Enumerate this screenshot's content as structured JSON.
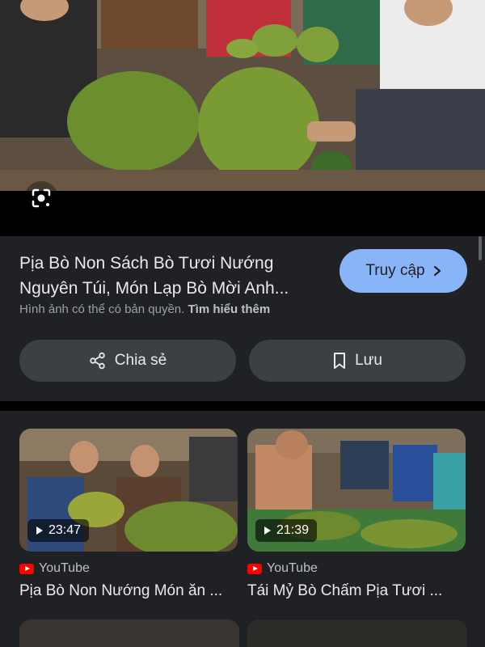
{
  "hero": {
    "image": "Ảnh: mọi người ngồi quanh những tảng thịt gói lá màu xanh"
  },
  "result": {
    "title": "Pịa Bò Non Sách Bò Tươi Nướng Nguyên Túi, Món Lạp Bò Mời Anh...",
    "visit_label": "Truy cập",
    "copyright_text": "Hình ảnh có thể có bản quyền.",
    "learn_more": "Tìm hiểu thêm",
    "share_label": "Chia sẻ",
    "save_label": "Lưu"
  },
  "related": [
    {
      "duration": "23:47",
      "source": "YouTube",
      "title": "Pịa Bò Non Nướng Món ăn ..."
    },
    {
      "duration": "21:39",
      "source": "YouTube",
      "title": "Tái Mỷ Bò Chấm Pịa Tươi ..."
    }
  ],
  "icons": {
    "lens": "google-lens-icon",
    "visit": "chevron-right-icon",
    "share": "share-icon",
    "save": "bookmark-icon",
    "play": "play-icon",
    "youtube": "youtube-logo"
  },
  "colors": {
    "accent": "#8ab4f8",
    "background": "#202124",
    "button": "#3c4043"
  }
}
